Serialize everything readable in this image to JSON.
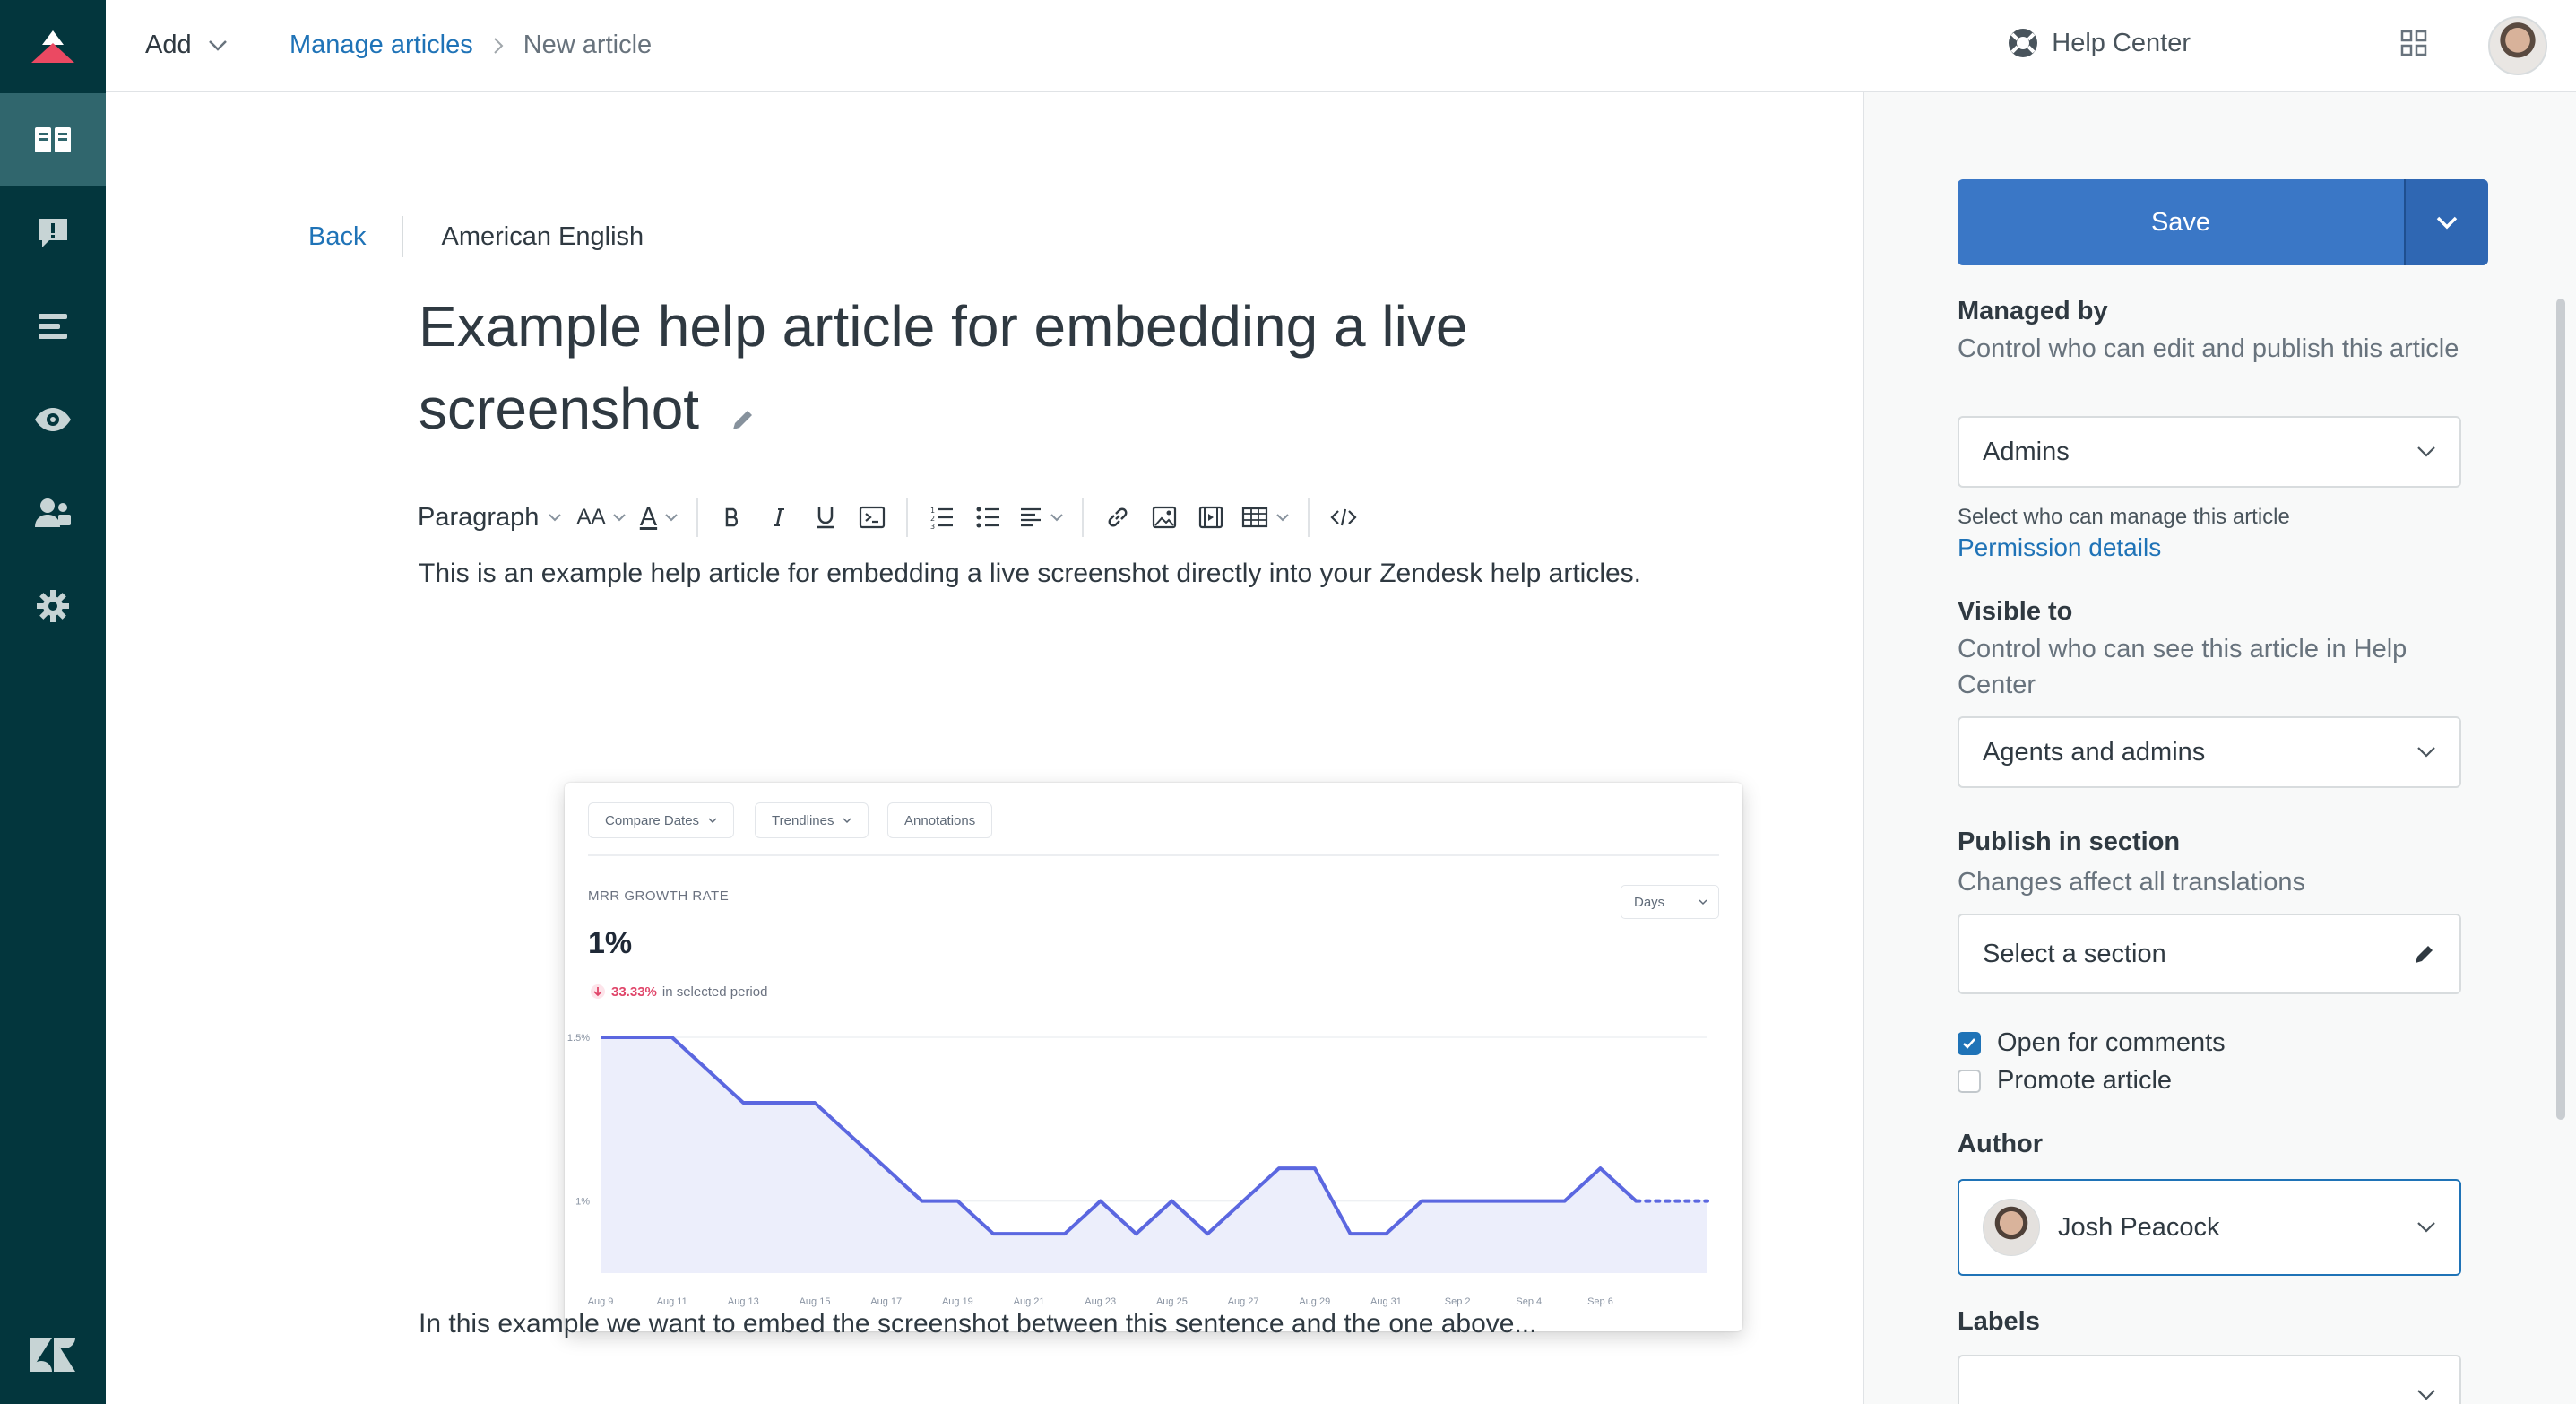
{
  "nav": {
    "items": [
      "guide-icon",
      "feedback-icon",
      "arrange-icon",
      "preview-icon",
      "user-permissions-icon",
      "settings-icon"
    ],
    "active_index": 0
  },
  "header": {
    "add_label": "Add",
    "breadcrumb": {
      "link": "Manage articles",
      "current": "New article"
    },
    "help_center_label": "Help Center"
  },
  "editor": {
    "back_label": "Back",
    "language": "American English",
    "title_line1": "Example help article for embedding a live",
    "title_line2": "screenshot",
    "toolbar": {
      "paragraph_label": "Paragraph",
      "font_size_label": "AA",
      "text_color_label": "A"
    },
    "paragraph1": "This is an example help article for embedding a live screenshot directly into your Zendesk help articles.",
    "paragraph2": "In this example we want to embed the screenshot between this sentence and the one above..."
  },
  "embedded": {
    "chips": [
      "Compare Dates",
      "Trendlines",
      "Annotations"
    ],
    "metric_label": "MRR GROWTH RATE",
    "metric_value": "1%",
    "delta_value": "33.33%",
    "delta_suffix": "in selected period",
    "days_label": "Days"
  },
  "chart_data": {
    "type": "area",
    "title": "MRR GROWTH RATE",
    "xlabel": "",
    "ylabel": "",
    "x_ticks": [
      "Aug 9",
      "Aug 11",
      "Aug 13",
      "Aug 15",
      "Aug 17",
      "Aug 19",
      "Aug 21",
      "Aug 23",
      "Aug 25",
      "Aug 27",
      "Aug 29",
      "Aug 31",
      "Sep 2",
      "Sep 4",
      "Sep 6"
    ],
    "y_ticks": [
      "1.5%",
      "1%"
    ],
    "ylim": [
      0.78,
      1.5
    ],
    "series": [
      {
        "values": [
          1.5,
          1.5,
          1.5,
          1.4,
          1.3,
          1.3,
          1.3,
          1.2,
          1.1,
          1.0,
          1.0,
          0.9,
          0.9,
          0.9,
          1.0,
          0.9,
          1.0,
          0.9,
          1.0,
          1.1,
          1.1,
          0.9,
          0.9,
          1.0,
          1.0,
          1.0,
          1.0,
          1.0,
          1.1,
          1.0,
          1.0,
          1.0
        ],
        "projected_from_index": 29
      }
    ],
    "color": "#5b67e0",
    "fill": "#eceefb"
  },
  "panel": {
    "save_label": "Save",
    "managed_by": {
      "label": "Managed by",
      "hint": "Control who can edit and publish this article",
      "value": "Admins",
      "note": "Select who can manage this article",
      "link": "Permission details"
    },
    "visible_to": {
      "label": "Visible to",
      "hint": "Control who can see this article in Help Center",
      "value": "Agents and admins"
    },
    "publish": {
      "label": "Publish in section",
      "hint": "Changes affect all translations",
      "value": "Select a section"
    },
    "open_for_comments": {
      "label": "Open for comments",
      "checked": true
    },
    "promote_article": {
      "label": "Promote article",
      "checked": false
    },
    "author": {
      "label": "Author",
      "value": "Josh Peacock"
    },
    "labels": {
      "label": "Labels",
      "value": ""
    }
  }
}
